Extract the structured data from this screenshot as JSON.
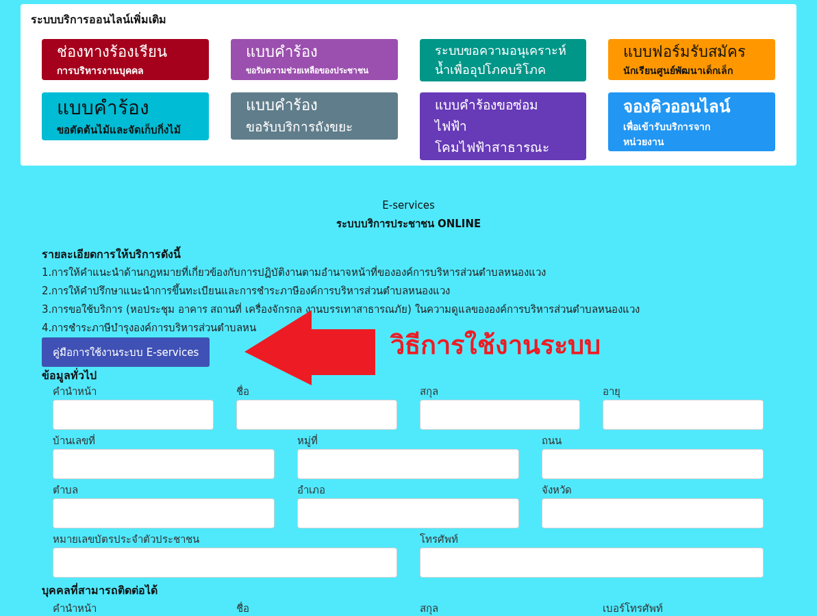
{
  "online_services": {
    "title": "ระบบบริการออนไลน์เพิ่มเติม",
    "buttons": [
      {
        "color": "#a5001c",
        "lines": [
          {
            "kind": "title",
            "text": "ช่องทางร้องเรียน"
          },
          {
            "kind": "note",
            "text": "การบริหารงานบุคคล"
          }
        ]
      },
      {
        "color": "#9b4fae",
        "lines": [
          {
            "kind": "title",
            "text": "แบบคำร้อง"
          },
          {
            "kind": "note_small",
            "text": "ขอรับความช่วยเหลือของประชาชน"
          }
        ]
      },
      {
        "color": "#009688",
        "lines": [
          {
            "kind": "text",
            "text": "ระบบขอความอนุเคราะห์"
          },
          {
            "kind": "text",
            "text": "น้ำเพื่ออุปโภคบริโภค"
          }
        ]
      },
      {
        "color": "#ff9800",
        "lines": [
          {
            "kind": "title",
            "text": "แบบฟอร์มรับสมัคร"
          },
          {
            "kind": "note",
            "text": "นักเรียนศูนย์พัฒนาเด็กเล็ก"
          }
        ]
      },
      {
        "color": "#00bcd4",
        "lines": [
          {
            "kind": "title_large",
            "text": "แบบคำร้อง"
          },
          {
            "kind": "note_large",
            "text": "ขอตัดต้นไม้และจัดเก็บกิ่งไม้"
          }
        ]
      },
      {
        "color": "#607d8b",
        "lines": [
          {
            "kind": "title",
            "text": "แบบคำร้อง"
          },
          {
            "kind": "text_large",
            "text": "ขอรับบริการถังขยะ"
          }
        ]
      },
      {
        "color": "#673ab7",
        "lines": [
          {
            "kind": "text_large",
            "text": "แบบคำร้องขอซ่อม"
          },
          {
            "kind": "text_large",
            "text": "ไฟฟ้า"
          },
          {
            "kind": "text_large",
            "text": "โคมไฟฟ้าสาธารณะ"
          }
        ]
      },
      {
        "color": "#2196f3",
        "lines": [
          {
            "kind": "title_bold",
            "text": "จองคิวออนไลน์"
          },
          {
            "kind": "note",
            "text": "เพื่อเข้ารับบริการจาก"
          },
          {
            "kind": "note",
            "text": "หน่วยงาน"
          }
        ]
      }
    ]
  },
  "intro": {
    "title": "E-services",
    "subtitle": "ระบบบริการประชาชน ONLINE"
  },
  "details": {
    "heading": "รายละเอียดการให้บริการดังนี้",
    "items": [
      "1.การให้คำแนะนำด้านกฎหมายที่เกี่ยวข้องกับการปฏิบัติงานตามอำนาจหน้าที่ขององค์การบริหารส่วนตำบลหนองแวง",
      "2.การให้คำปรึกษาแนะนำการขึ้นทะเบียนและการชำระภาษีองค์การบริหารส่วนตำบลหนองแวง",
      "3.การขอใช้บริการ (หอประชุม อาคาร สถานที่ เครื่องจักรกล งานบรรเทาสาธารณภัย) ในความดูแลขององค์การบริหารส่วนตำบลหนองแวง",
      "4.การชำระภาษีบำรุงองค์การบริหารส่วนตำบลหน"
    ]
  },
  "manual_button": "คู่มือการใช้งานระบบ E-services",
  "annotation": {
    "text": "วิธีการใช้งานระบบ"
  },
  "general_info": {
    "heading": "ข้อมูลทั่วไป",
    "rows": [
      [
        {
          "label": "คำนำหน้า"
        },
        {
          "label": "ชื่อ"
        },
        {
          "label": "สกุล"
        },
        {
          "label": "อายุ"
        }
      ],
      [
        {
          "label": "บ้านเลขที่"
        },
        {
          "label": "หมู่ที่"
        },
        {
          "label": "ถนน"
        }
      ],
      [
        {
          "label": "ตำบล"
        },
        {
          "label": "อำเภอ"
        },
        {
          "label": "จังหวัด"
        }
      ],
      [
        {
          "label": "หมายเลขบัตรประจำตัวประชาชน"
        },
        {
          "label": "โทรศัพท์"
        }
      ]
    ]
  },
  "contact": {
    "heading": "บุคคลที่สามารถติดต่อได้",
    "labels": [
      "คำนำหน้า",
      "ชื่อ",
      "สกุล",
      "เบอร์โทรศัพท์"
    ]
  }
}
